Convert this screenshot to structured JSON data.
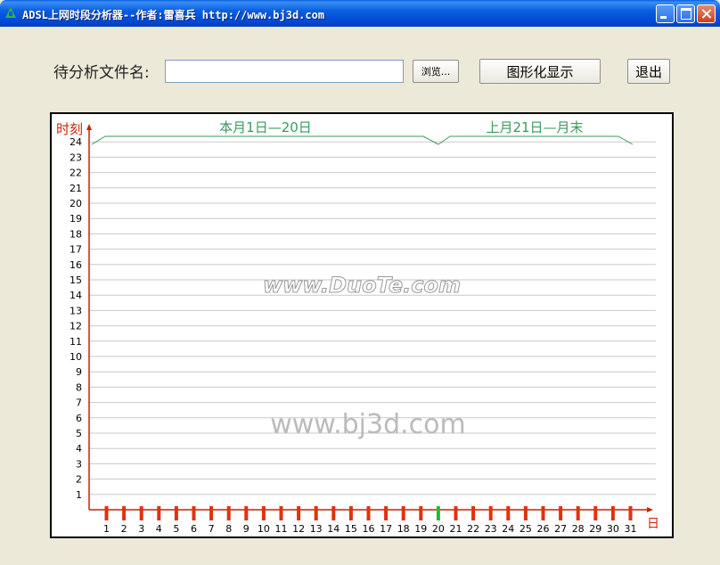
{
  "window": {
    "title": "ADSL上网时段分析器--作者:雷喜兵 http://www.bj3d.com"
  },
  "form": {
    "file_label": "待分析文件名:",
    "file_value": "",
    "browse_label": "浏览...",
    "graph_label": "图形化显示",
    "exit_label": "退出"
  },
  "chart_data": {
    "type": "bar",
    "ylabel": "时刻",
    "xlabel": "日",
    "y_ticks": [
      1,
      2,
      3,
      4,
      5,
      6,
      7,
      8,
      9,
      10,
      11,
      12,
      13,
      14,
      15,
      16,
      17,
      18,
      19,
      20,
      21,
      22,
      23,
      24
    ],
    "ylim": [
      0,
      24
    ],
    "categories": [
      "1",
      "2",
      "3",
      "4",
      "5",
      "6",
      "7",
      "8",
      "9",
      "10",
      "11",
      "12",
      "13",
      "14",
      "15",
      "16",
      "17",
      "18",
      "19",
      "20",
      "21",
      "22",
      "23",
      "24",
      "25",
      "26",
      "27",
      "28",
      "29",
      "30",
      "31"
    ],
    "highlight_day": "20",
    "bracket_left": "本月1日—20日",
    "bracket_right": "上月21日—月末",
    "watermarks": [
      "www.DuoTe.com",
      "www.bj3d.com"
    ],
    "colors": {
      "axis": "#cc2200",
      "day_mark": "#dd3311",
      "highlight": "#22bb33",
      "bracket": "#3a9a5a",
      "grid": "#c8c8c8"
    }
  }
}
